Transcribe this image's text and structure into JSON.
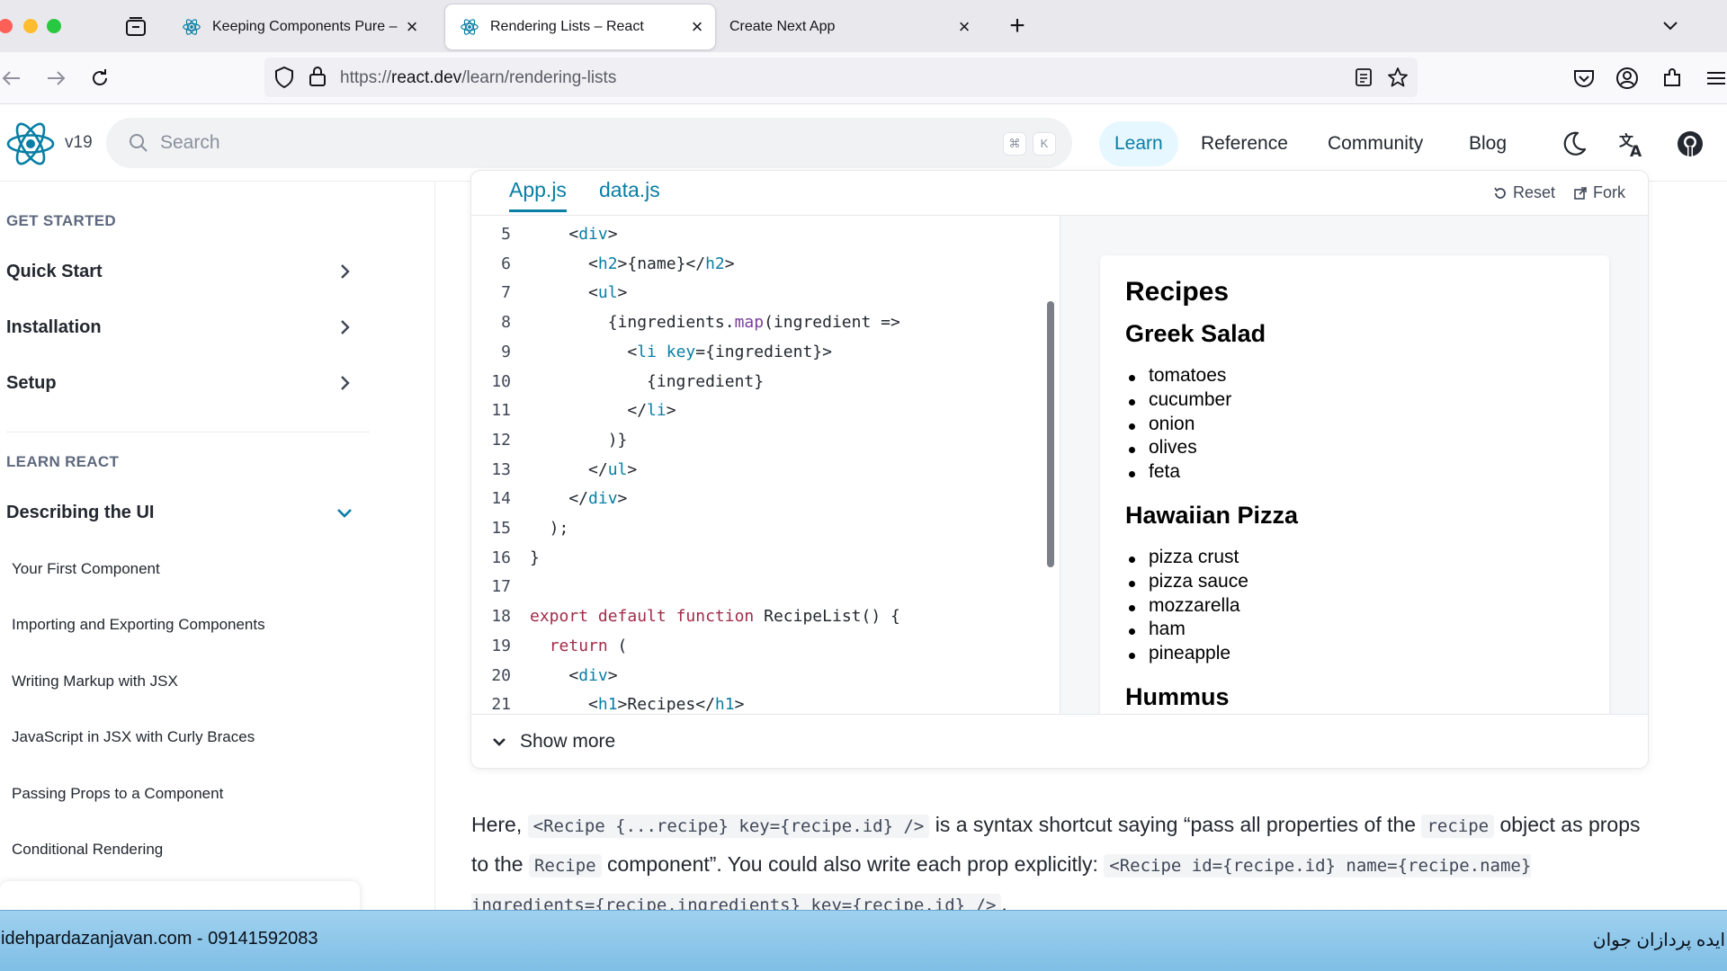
{
  "browser": {
    "tabs": [
      {
        "label": "Keeping Components Pure – Re",
        "active": false
      },
      {
        "label": "Rendering Lists – React",
        "active": true
      },
      {
        "label": "Create Next App",
        "active": false
      }
    ],
    "url_prefix": "https://",
    "url_domain": "react.dev",
    "url_path": "/learn/rendering-lists"
  },
  "site": {
    "version": "v19",
    "search_placeholder": "Search",
    "kbd_cmd": "⌘",
    "kbd_k": "K",
    "nav": [
      "Learn",
      "Reference",
      "Community",
      "Blog"
    ],
    "active_nav": "Learn"
  },
  "sidebar": {
    "get_started_title": "GET STARTED",
    "get_started": [
      "Quick Start",
      "Installation",
      "Setup"
    ],
    "learn_title": "LEARN REACT",
    "expanded_section": "Describing the UI",
    "sub_items": [
      "Your First Component",
      "Importing and Exporting Components",
      "Writing Markup with JSX",
      "JavaScript in JSX with Curly Braces",
      "Passing Props to a Component",
      "Conditional Rendering"
    ]
  },
  "sandpack": {
    "files": [
      "App.js",
      "data.js"
    ],
    "active_file": "App.js",
    "reset_label": "Reset",
    "fork_label": "Fork",
    "show_more_label": "Show more",
    "code_lines": [
      {
        "n": "5",
        "code": "    <div>"
      },
      {
        "n": "6",
        "code": "      <h2>{name}</h2>"
      },
      {
        "n": "7",
        "code": "      <ul>"
      },
      {
        "n": "8",
        "code": "        {ingredients.map(ingredient =>"
      },
      {
        "n": "9",
        "code": "          <li key={ingredient}>"
      },
      {
        "n": "10",
        "code": "            {ingredient}"
      },
      {
        "n": "11",
        "code": "          </li>"
      },
      {
        "n": "12",
        "code": "        )}"
      },
      {
        "n": "13",
        "code": "      </ul>"
      },
      {
        "n": "14",
        "code": "    </div>"
      },
      {
        "n": "15",
        "code": "  );"
      },
      {
        "n": "16",
        "code": "}"
      },
      {
        "n": "17",
        "code": ""
      },
      {
        "n": "18",
        "code": "export default function RecipeList() {"
      },
      {
        "n": "19",
        "code": "  return ("
      },
      {
        "n": "20",
        "code": "    <div>"
      },
      {
        "n": "21",
        "code": "      <h1>Recipes</h1>"
      }
    ],
    "preview": {
      "title": "Recipes",
      "recipes": [
        {
          "name": "Greek Salad",
          "ingredients": [
            "tomatoes",
            "cucumber",
            "onion",
            "olives",
            "feta"
          ]
        },
        {
          "name": "Hawaiian Pizza",
          "ingredients": [
            "pizza crust",
            "pizza sauce",
            "mozzarella",
            "ham",
            "pineapple"
          ]
        },
        {
          "name": "Hummus",
          "ingredients": []
        }
      ]
    }
  },
  "prose": {
    "t1": "Here, ",
    "c1": "<Recipe {...recipe} key={recipe.id} />",
    "t2": " is a syntax shortcut saying “pass all properties of the ",
    "c2": "recipe",
    "t3": " object as props to the ",
    "c3": "Recipe",
    "t4": " component”. You could also write each prop explicitly: ",
    "c4": "<Recipe id={recipe.id} name={recipe.name} ingredients={recipe.ingredients} key={recipe.id} />",
    "t5": "."
  },
  "watermark": {
    "left": "idehpardazanjavan.com - 09141592083",
    "right": "ایده پردازان جوان"
  }
}
